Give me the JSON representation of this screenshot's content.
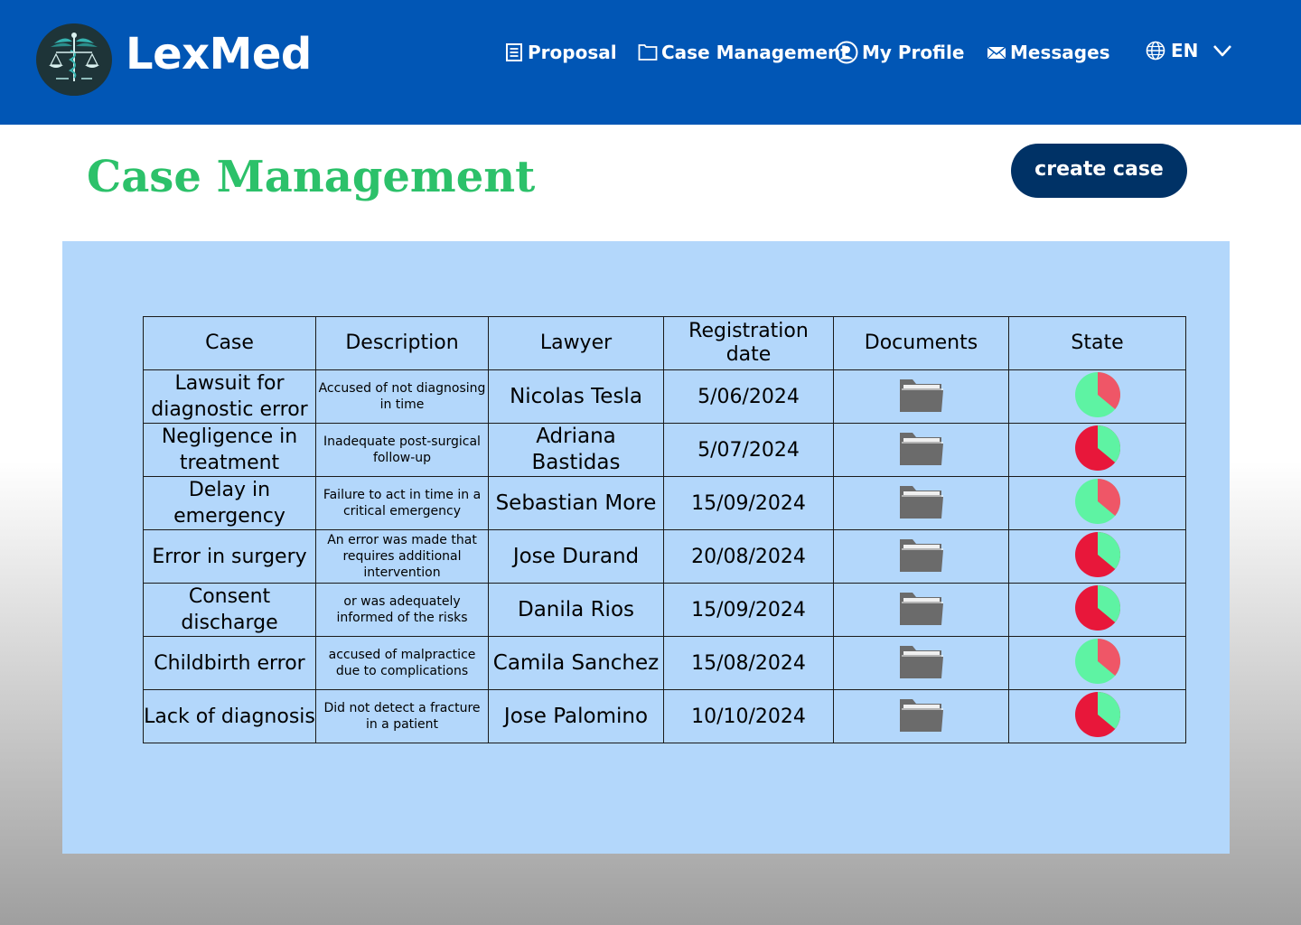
{
  "app": {
    "brand": "LexMed",
    "logo_name": "lexmed-logo"
  },
  "nav": {
    "items": [
      {
        "label": "Proposal",
        "icon": "document-icon"
      },
      {
        "label": "Case Management",
        "icon": "folder-icon"
      },
      {
        "label": "My Profile",
        "icon": "user-icon"
      },
      {
        "label": "Messages",
        "icon": "mail-icon"
      }
    ],
    "language": {
      "label": "EN",
      "icon": "globe-icon"
    }
  },
  "page": {
    "title": "Case Management",
    "create_label": "create case"
  },
  "table": {
    "headers": [
      "Case",
      "Description",
      "Lawyer",
      "Registration date",
      "Documents",
      "State"
    ],
    "rows": [
      {
        "case": "Lawsuit for diagnostic error",
        "description": "Accused of not diagnosing in time",
        "lawyer": "Nicolas Tesla",
        "date": "5/06/2024",
        "state": "mostly-green"
      },
      {
        "case": "Negligence in treatment",
        "description": "Inadequate post-surgical follow-up",
        "lawyer": "Adriana Bastidas",
        "date": "5/07/2024",
        "state": "mostly-red"
      },
      {
        "case": "Delay in emergency",
        "description": "Failure to act in time in a critical emergency",
        "lawyer": "Sebastian More",
        "date": "15/09/2024",
        "state": "mostly-green"
      },
      {
        "case": "Error in surgery",
        "description": "An error was made that requires additional intervention",
        "lawyer": "Jose Durand",
        "date": "20/08/2024",
        "state": "mostly-red"
      },
      {
        "case": "Consent discharge",
        "description": "or was adequately informed of the risks",
        "lawyer": "Danila Rios",
        "date": "15/09/2024",
        "state": "mostly-red"
      },
      {
        "case": "Childbirth error",
        "description": "accused of malpractice due to complications",
        "lawyer": "Camila Sanchez",
        "date": "15/08/2024",
        "state": "mostly-green"
      },
      {
        "case": "Lack of diagnosis",
        "description": "Did not detect a fracture in a patient",
        "lawyer": "Jose Palomino",
        "date": "10/10/2024",
        "state": "mostly-red"
      }
    ]
  },
  "colors": {
    "header_bg": "#0156b5",
    "title_green": "#2cc16a",
    "button_bg": "#003266",
    "panel_bg": "#b3d7fb",
    "state_green": "#5ef3a3",
    "state_red": "#e8173a",
    "state_red_light": "#ef5667",
    "folder_gray": "#6b6b6b"
  }
}
